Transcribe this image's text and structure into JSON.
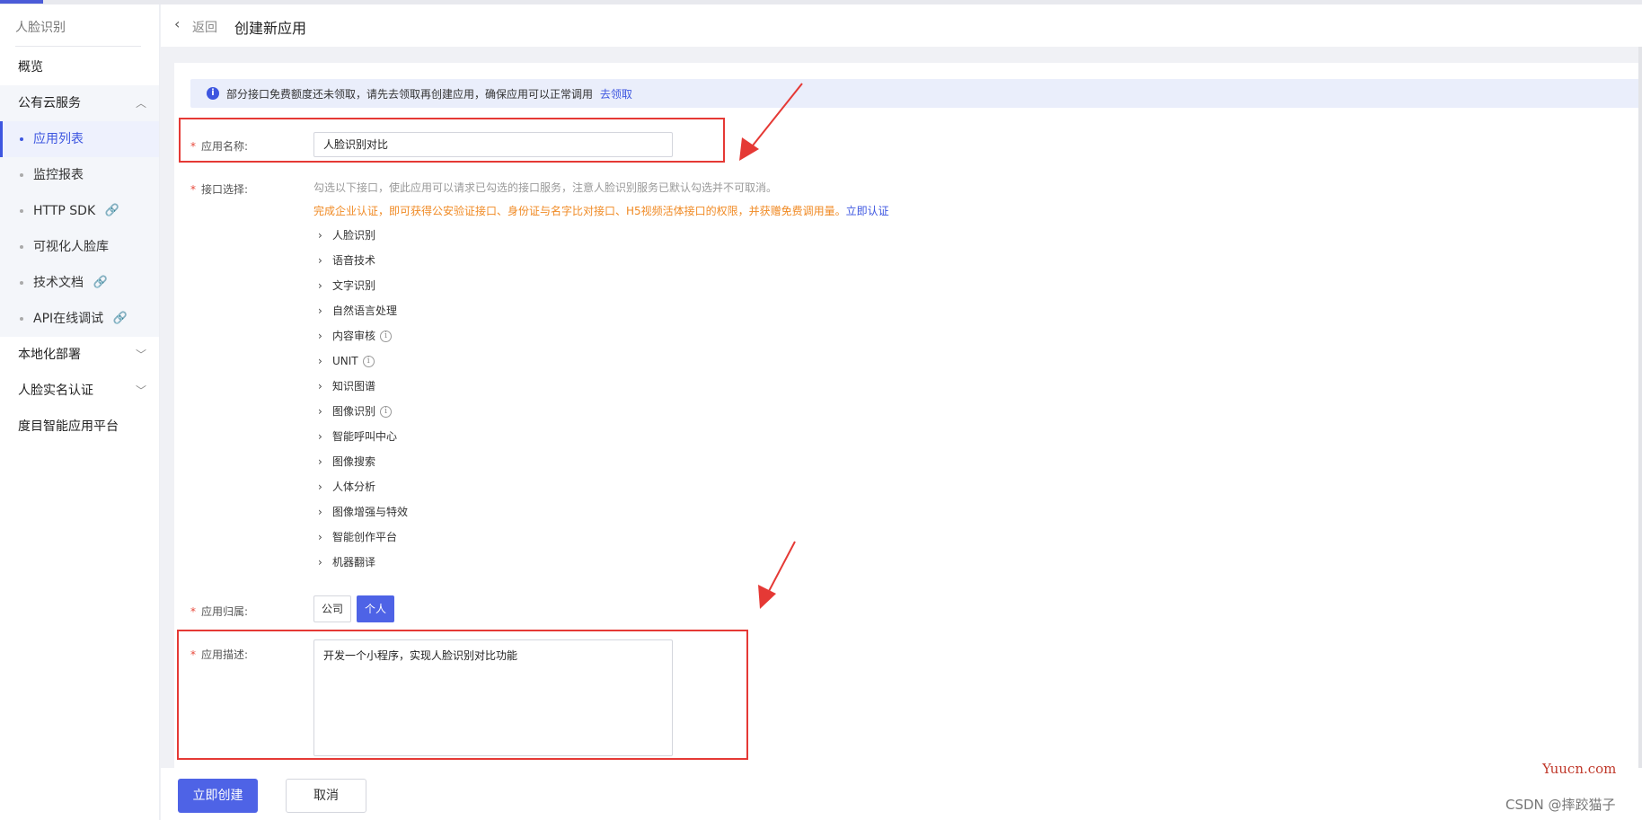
{
  "sidebar": {
    "title": "人脸识别",
    "overview": "概览",
    "public_cloud": "公有云服务",
    "sub_items": [
      "应用列表",
      "监控报表",
      "HTTP SDK",
      "可视化人脸库",
      "技术文档",
      "API在线调试"
    ],
    "local_deploy": "本地化部署",
    "face_realname": "人脸实名认证",
    "dumu_platform": "度目智能应用平台"
  },
  "header": {
    "back_label": "返回",
    "title": "创建新应用"
  },
  "notice": {
    "text": "部分接口免费额度还未领取，请先去领取再创建应用，确保应用可以正常调用",
    "link": "去领取"
  },
  "form": {
    "app_name_label": "应用名称:",
    "app_name_value": "人脸识别对比",
    "api_select_label": "接口选择:",
    "api_hint": "勾选以下接口，使此应用可以请求已勾选的接口服务，注意人脸识别服务已默认勾选并不可取消。",
    "enterprise_hint": "完成企业认证，即可获得公安验证接口、身份证与名字比对接口、H5视频活体接口的权限，并获赠免费调用量。",
    "enterprise_link": "立即认证",
    "api_groups": [
      "人脸识别",
      "语音技术",
      "文字识别",
      "自然语言处理",
      "内容审核",
      "UNIT",
      "知识图谱",
      "图像识别",
      "智能呼叫中心",
      "图像搜索",
      "人体分析",
      "图像增强与特效",
      "智能创作平台",
      "机器翻译"
    ],
    "owner_label": "应用归属:",
    "owner_company": "公司",
    "owner_personal": "个人",
    "desc_label": "应用描述:",
    "desc_value": "开发一个小程序，实现人脸识别对比功能"
  },
  "footer": {
    "create_label": "立即创建",
    "cancel_label": "取消"
  },
  "watermark": {
    "site": "Yuucn.com",
    "author": "CSDN @摔跤猫子"
  },
  "colors": {
    "accent": "#4e63e6",
    "annotation_red": "#e53935",
    "hint_orange": "#f08a24"
  }
}
